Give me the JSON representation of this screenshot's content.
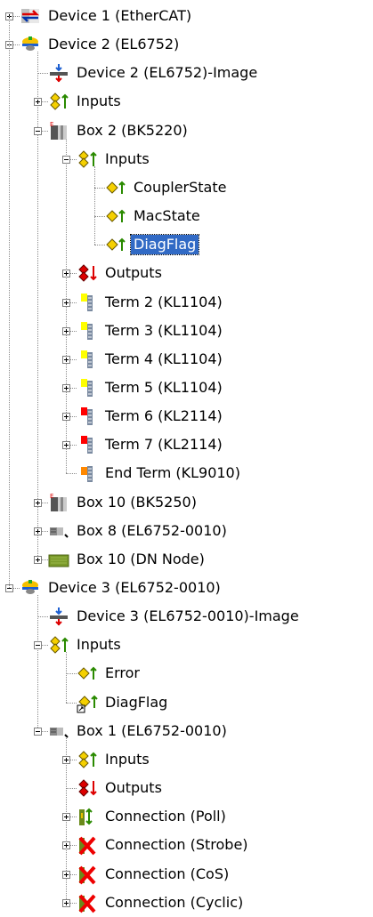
{
  "tree": [
    {
      "label": "Device 1 (EtherCAT)",
      "depth": 0,
      "toggle": "plus",
      "icon": "ethercat-device-icon",
      "selected": false
    },
    {
      "label": "Device 2 (EL6752)",
      "depth": 0,
      "toggle": "minus",
      "icon": "fieldbus-device-icon",
      "selected": false
    },
    {
      "label": "Device 2 (EL6752)-Image",
      "depth": 1,
      "toggle": null,
      "icon": "process-image-icon",
      "selected": false
    },
    {
      "label": "Inputs",
      "depth": 1,
      "toggle": "plus",
      "icon": "inputs-icon",
      "selected": false
    },
    {
      "label": "Box 2 (BK5220)",
      "depth": 1,
      "toggle": "minus",
      "icon": "bus-coupler-icon",
      "selected": false
    },
    {
      "label": "Inputs",
      "depth": 2,
      "toggle": "minus",
      "icon": "inputs-icon",
      "selected": false
    },
    {
      "label": "CouplerState",
      "depth": 3,
      "toggle": null,
      "icon": "input-variable-icon",
      "selected": false
    },
    {
      "label": "MacState",
      "depth": 3,
      "toggle": null,
      "icon": "input-variable-icon",
      "selected": false
    },
    {
      "label": "DiagFlag",
      "depth": 3,
      "toggle": null,
      "icon": "input-variable-icon",
      "selected": true
    },
    {
      "label": "Outputs",
      "depth": 2,
      "toggle": "plus",
      "icon": "outputs-icon",
      "selected": false
    },
    {
      "label": "Term 2 (KL1104)",
      "depth": 2,
      "toggle": "plus",
      "icon": "terminal-yellow-icon",
      "selected": false
    },
    {
      "label": "Term 3 (KL1104)",
      "depth": 2,
      "toggle": "plus",
      "icon": "terminal-yellow-icon",
      "selected": false
    },
    {
      "label": "Term 4 (KL1104)",
      "depth": 2,
      "toggle": "plus",
      "icon": "terminal-yellow-icon",
      "selected": false
    },
    {
      "label": "Term 5 (KL1104)",
      "depth": 2,
      "toggle": "plus",
      "icon": "terminal-yellow-icon",
      "selected": false
    },
    {
      "label": "Term 6 (KL2114)",
      "depth": 2,
      "toggle": "plus",
      "icon": "terminal-red-icon",
      "selected": false
    },
    {
      "label": "Term 7 (KL2114)",
      "depth": 2,
      "toggle": "plus",
      "icon": "terminal-red-icon",
      "selected": false
    },
    {
      "label": "End Term (KL9010)",
      "depth": 2,
      "toggle": null,
      "icon": "terminal-orange-icon",
      "selected": false
    },
    {
      "label": "Box 10 (BK5250)",
      "depth": 1,
      "toggle": "plus",
      "icon": "bus-coupler-icon",
      "selected": false
    },
    {
      "label": "Box 8 (EL6752-0010)",
      "depth": 1,
      "toggle": "plus",
      "icon": "box-module-icon",
      "selected": false
    },
    {
      "label": "Box 10 (DN Node)",
      "depth": 1,
      "toggle": "plus",
      "icon": "dn-node-icon",
      "selected": false
    },
    {
      "label": "Device 3 (EL6752-0010)",
      "depth": 0,
      "toggle": "minus",
      "icon": "fieldbus-device-icon",
      "selected": false
    },
    {
      "label": "Device 3 (EL6752-0010)-Image",
      "depth": 1,
      "toggle": null,
      "icon": "process-image-icon",
      "selected": false
    },
    {
      "label": "Inputs",
      "depth": 1,
      "toggle": "minus",
      "icon": "inputs-icon",
      "selected": false
    },
    {
      "label": "Error",
      "depth": 2,
      "toggle": null,
      "icon": "input-variable-icon",
      "selected": false
    },
    {
      "label": "DiagFlag",
      "depth": 2,
      "toggle": null,
      "icon": "linked-input-variable-icon",
      "selected": false
    },
    {
      "label": "Box 1 (EL6752-0010)",
      "depth": 1,
      "toggle": "minus",
      "icon": "box-module-icon",
      "selected": false
    },
    {
      "label": "Inputs",
      "depth": 2,
      "toggle": "plus",
      "icon": "inputs-icon",
      "selected": false
    },
    {
      "label": "Outputs",
      "depth": 2,
      "toggle": null,
      "icon": "outputs-icon",
      "selected": false
    },
    {
      "label": "Connection (Poll)",
      "depth": 2,
      "toggle": "plus",
      "icon": "connection-active-icon",
      "selected": false
    },
    {
      "label": "Connection (Strobe)",
      "depth": 2,
      "toggle": "plus",
      "icon": "connection-disabled-icon",
      "selected": false
    },
    {
      "label": "Connection (CoS)",
      "depth": 2,
      "toggle": "plus",
      "icon": "connection-disabled-icon",
      "selected": false
    },
    {
      "label": "Connection (Cyclic)",
      "depth": 2,
      "toggle": "plus",
      "icon": "connection-disabled-icon",
      "selected": false
    }
  ],
  "colors": {
    "selection": "#316ac5",
    "tree_line": "#8a8a8a",
    "terminal_yellow": "#ffff00",
    "terminal_red": "#ff0000",
    "terminal_orange": "#ff8800"
  }
}
